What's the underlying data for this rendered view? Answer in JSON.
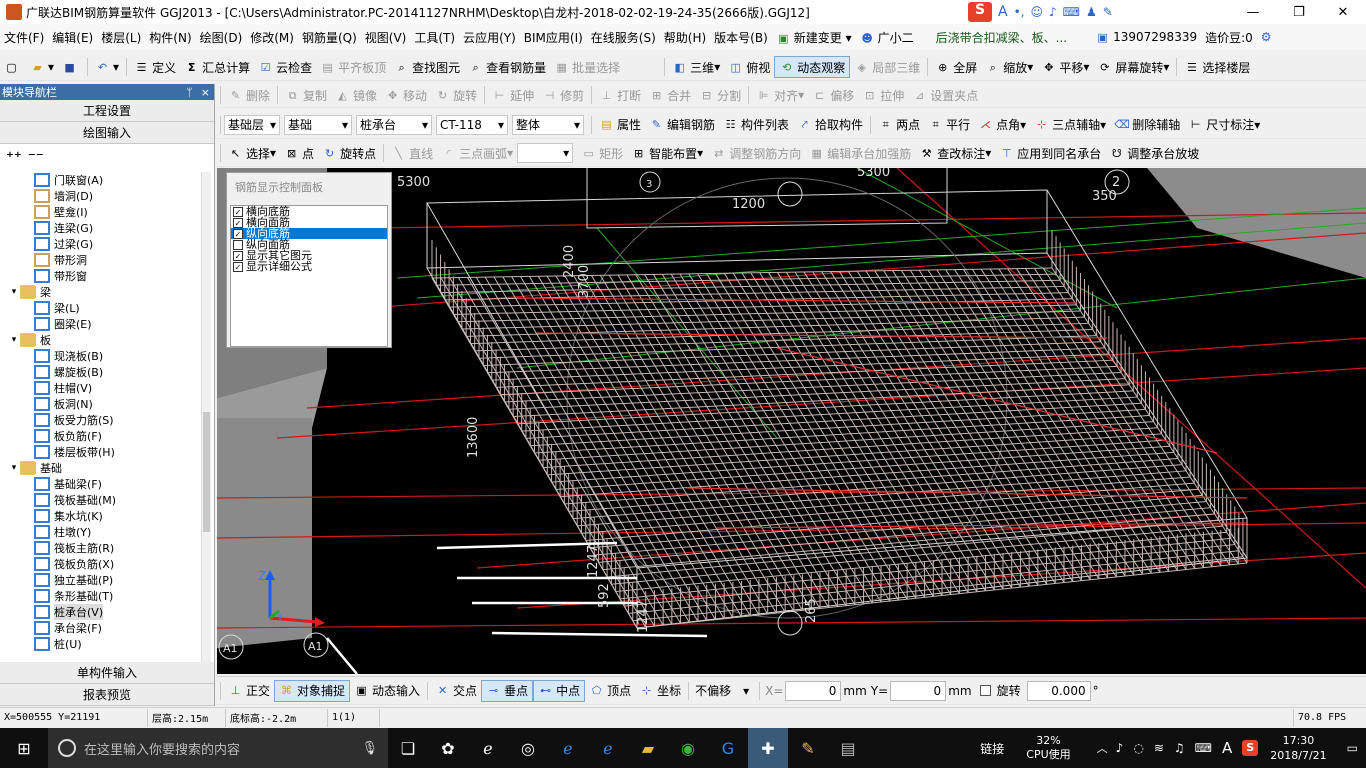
{
  "window": {
    "title": "广联达BIM钢筋算量软件 GGJ2013 - [C:\\Users\\Administrator.PC-20141127NRHM\\Desktop\\白龙村-2018-02-02-19-24-35(2666版).GGJ12]",
    "minimize": "—",
    "maximize": "❐",
    "close": "✕"
  },
  "menu": {
    "items": [
      "文件(F)",
      "编辑(E)",
      "楼层(L)",
      "构件(N)",
      "绘图(D)",
      "修改(M)",
      "钢筋量(Q)",
      "视图(V)",
      "工具(T)",
      "云应用(Y)",
      "BIM应用(I)",
      "在线服务(S)",
      "帮助(H)",
      "版本号(B)"
    ],
    "new_change": "新建变更",
    "assistant": "广小二",
    "notice": "后浇带合扣减梁、板、...",
    "phone": "13907298339",
    "beans": "造价豆:0"
  },
  "toolbar1": {
    "define": "定义",
    "sum_calc": "汇总计算",
    "cloud_check": "云检查",
    "level_slab_top": "平齐板顶",
    "find_element": "查找图元",
    "view_rebar": "查看钢筋量",
    "batch_select": "批量选择",
    "three_d": "三维",
    "top_view": "俯视",
    "dynamic_view": "动态观察",
    "local_3d": "局部三维",
    "fullscreen": "全屏",
    "zoom": "缩放",
    "pan": "平移",
    "screen_rotate": "屏幕旋转",
    "select_floor": "选择楼层"
  },
  "toolbar2": {
    "items": [
      "删除",
      "复制",
      "镜像",
      "移动",
      "旋转",
      "延伸",
      "修剪",
      "打断",
      "合并",
      "分割",
      "对齐",
      "偏移",
      "拉伸",
      "设置夹点"
    ]
  },
  "toolbar3": {
    "floor": "基础层",
    "category": "基础",
    "component_type": "桩承台",
    "component": "CT-118",
    "part": "整体",
    "properties": "属性",
    "edit_rebar": "编辑钢筋",
    "component_list": "构件列表",
    "pick_component": "拾取构件",
    "two_points": "两点",
    "parallel": "平行",
    "point_angle": "点角",
    "three_point_aux": "三点辅轴",
    "delete_aux": "删除辅轴",
    "dimension": "尺寸标注"
  },
  "toolbar4": {
    "select": "选择",
    "point": "点",
    "rotate_point": "旋转点",
    "line": "直线",
    "three_point_arc": "三点画弧",
    "rectangle": "矩形",
    "smart_layout": "智能布置",
    "adjust_rebar_dir": "调整钢筋方向",
    "edit_reinforce": "编辑承台加强筋",
    "check_label": "查改标注",
    "apply_same_name": "应用到同名承台",
    "adjust_slope": "调整承台放坡"
  },
  "left_panel": {
    "title": "模块导航栏",
    "pin": "ᛘ",
    "close": "×",
    "project_settings": "工程设置",
    "drawing_input": "绘图输入",
    "single_input": "单构件输入",
    "report_preview": "报表预览",
    "tree": [
      {
        "label": "门联窗(A)",
        "level": 2,
        "color": "#3a7bd5"
      },
      {
        "label": "墙洞(D)",
        "level": 2,
        "color": "#c8a060"
      },
      {
        "label": "壁龛(I)",
        "level": 2,
        "color": "#c8a060"
      },
      {
        "label": "连梁(G)",
        "level": 2,
        "color": "#3a7bd5"
      },
      {
        "label": "过梁(G)",
        "level": 2,
        "color": "#3a7bd5"
      },
      {
        "label": "带形洞",
        "level": 2,
        "color": "#c8a060"
      },
      {
        "label": "带形窗",
        "level": 2,
        "color": "#3a7bd5"
      },
      {
        "label": "梁",
        "level": 1,
        "folder": true
      },
      {
        "label": "梁(L)",
        "level": 2,
        "color": "#3a7bd5"
      },
      {
        "label": "圈梁(E)",
        "level": 2,
        "color": "#3a7bd5"
      },
      {
        "label": "板",
        "level": 1,
        "folder": true
      },
      {
        "label": "现浇板(B)",
        "level": 2,
        "color": "#3a7bd5"
      },
      {
        "label": "螺旋板(B)",
        "level": 2,
        "color": "#3a7bd5"
      },
      {
        "label": "柱帽(V)",
        "level": 2,
        "color": "#3a7bd5"
      },
      {
        "label": "板洞(N)",
        "level": 2,
        "color": "#3a7bd5"
      },
      {
        "label": "板受力筋(S)",
        "level": 2,
        "color": "#3a7bd5"
      },
      {
        "label": "板负筋(F)",
        "level": 2,
        "color": "#3a7bd5"
      },
      {
        "label": "楼层板带(H)",
        "level": 2,
        "color": "#3a7bd5"
      },
      {
        "label": "基础",
        "level": 1,
        "folder": true
      },
      {
        "label": "基础梁(F)",
        "level": 2,
        "color": "#3a7bd5"
      },
      {
        "label": "筏板基础(M)",
        "level": 2,
        "color": "#3a7bd5"
      },
      {
        "label": "集水坑(K)",
        "level": 2,
        "color": "#3a7bd5"
      },
      {
        "label": "柱墩(Y)",
        "level": 2,
        "color": "#3a7bd5"
      },
      {
        "label": "筏板主筋(R)",
        "level": 2,
        "color": "#3a7bd5"
      },
      {
        "label": "筏板负筋(X)",
        "level": 2,
        "color": "#3a7bd5"
      },
      {
        "label": "独立基础(P)",
        "level": 2,
        "color": "#3a7bd5"
      },
      {
        "label": "条形基础(T)",
        "level": 2,
        "color": "#3a7bd5"
      },
      {
        "label": "桩承台(V)",
        "level": 2,
        "color": "#3a7bd5",
        "selected": true
      },
      {
        "label": "承台梁(F)",
        "level": 2,
        "color": "#3a7bd5"
      },
      {
        "label": "桩(U)",
        "level": 2,
        "color": "#3a7bd5"
      }
    ]
  },
  "control_panel": {
    "title": "钢筋显示控制面板",
    "options": [
      {
        "label": "横向底筋",
        "checked": true,
        "highlight": false
      },
      {
        "label": "横向面筋",
        "checked": true,
        "highlight": false
      },
      {
        "label": "纵向底筋",
        "checked": true,
        "highlight": true
      },
      {
        "label": "纵向面筋",
        "checked": false,
        "highlight": false
      },
      {
        "label": "显示其它图元",
        "checked": true,
        "highlight": false
      },
      {
        "label": "显示详细公式",
        "checked": true,
        "highlight": false
      }
    ]
  },
  "canvas_labels": {
    "d5300a": "5300",
    "d5300b": "5300",
    "d1200": "1200",
    "d2400": "2400",
    "d3700": "3700",
    "d13600": "13600",
    "d350": "350",
    "d1247a": "1247",
    "d1247b": "1247",
    "d592": "592",
    "d265": "265",
    "axis_2": "2",
    "axis_3": "3",
    "axis_a1a": "A1",
    "axis_a1b": "A1",
    "z": "Z",
    "y": "Y"
  },
  "snapbar": {
    "ortho": "正交",
    "object_snap": "对象捕捉",
    "dynamic_input": "动态输入",
    "intersection": "交点",
    "perpendicular": "垂点",
    "midpoint": "中点",
    "vertex": "顶点",
    "coordinate": "坐标",
    "offset_mode": "不偏移",
    "x_label": "X=",
    "x_value": "0",
    "y_label": "Y=",
    "y_value": "0",
    "unit": "mm",
    "rotate": "旋转",
    "rotate_value": "0.000",
    "degree": "°"
  },
  "status": {
    "coords": "X=500555  Y=21191",
    "floor_height": "层高:2.15m",
    "bottom_elev": "底标高:-2.2m",
    "count": "1(1)",
    "fps": "70.8 FPS"
  },
  "taskbar": {
    "search_placeholder": "在这里输入你要搜索的内容",
    "link": "链接",
    "cpu_pct": "32%",
    "cpu_label": "CPU使用",
    "time": "17:30",
    "date": "2018/7/21",
    "ime": "A"
  }
}
